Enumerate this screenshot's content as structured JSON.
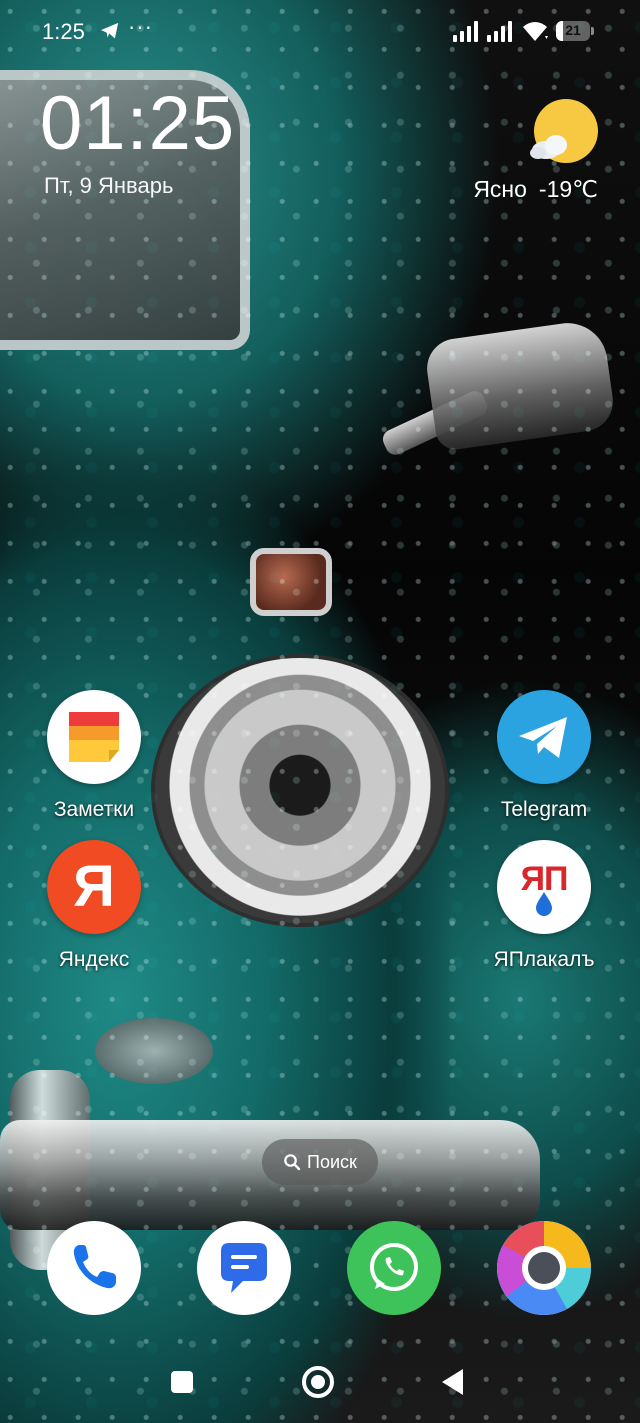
{
  "status_bar": {
    "time": "1:25",
    "more": "···",
    "battery_level": "21",
    "icons": [
      "telegram-notification-icon",
      "signal-icon",
      "signal-icon",
      "wifi-icon",
      "battery-icon"
    ]
  },
  "clock_widget": {
    "time": "01:25",
    "date": "Пт, 9 Январь"
  },
  "weather_widget": {
    "condition": "Ясно",
    "temperature": "-19℃",
    "icon": "sun-cloud-icon"
  },
  "apps": [
    {
      "label": "Заметки",
      "icon": "notes-icon"
    },
    {
      "label": "Telegram",
      "icon": "telegram-icon"
    },
    {
      "label": "Яндекс",
      "icon": "yandex-icon"
    },
    {
      "label": "ЯПлакалъ",
      "icon": "yaplakal-icon"
    }
  ],
  "search": {
    "label": "Поиск",
    "icon": "search-icon"
  },
  "dock": [
    {
      "name": "phone",
      "icon": "phone-icon"
    },
    {
      "name": "messages",
      "icon": "messages-icon"
    },
    {
      "name": "whatsapp",
      "icon": "whatsapp-icon"
    },
    {
      "name": "chrome",
      "icon": "chrome-icon"
    }
  ],
  "yaplakal_logo": "ЯП",
  "yandex_logo": "Я",
  "navigation": [
    "recents-button",
    "home-button",
    "back-button"
  ],
  "colors": {
    "telegram": "#2AA3E0",
    "yandex": "#F04B23",
    "whatsapp": "#3EC25A",
    "messages": "#2F6BE8"
  }
}
